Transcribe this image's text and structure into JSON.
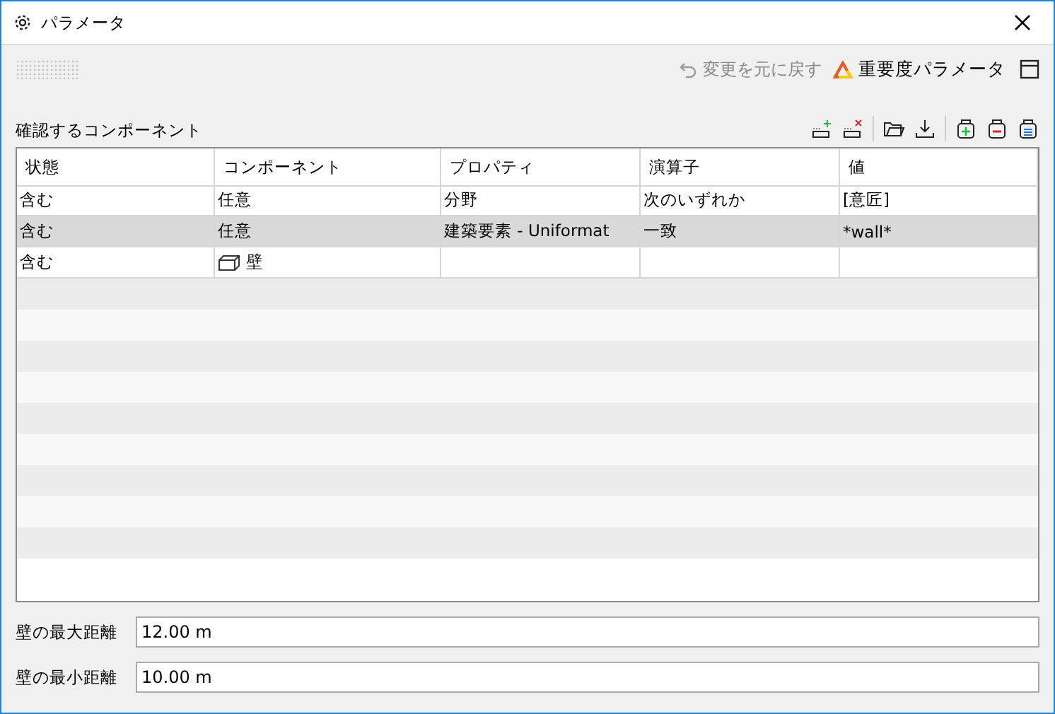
{
  "window": {
    "title": "パラメータ"
  },
  "toolbar": {
    "undo": {
      "label": "変更を元に戻す",
      "disabled": true
    },
    "severity": {
      "label": "重要度パラメータ"
    }
  },
  "section": {
    "title": "確認するコンポーネント"
  },
  "table": {
    "columns": [
      "状態",
      "コンポーネント",
      "プロパティ",
      "演算子",
      "値"
    ],
    "rows": [
      {
        "selected": false,
        "cells": [
          {
            "text": "含む"
          },
          {
            "text": "任意"
          },
          {
            "text": "分野"
          },
          {
            "text": "次のいずれか"
          },
          {
            "text": "[意匠]"
          }
        ]
      },
      {
        "selected": true,
        "cells": [
          {
            "text": "含む"
          },
          {
            "text": "任意"
          },
          {
            "text": "建築要素 - Uniformat"
          },
          {
            "text": "一致"
          },
          {
            "text": "*wall*"
          }
        ]
      },
      {
        "selected": false,
        "cells": [
          {
            "text": "含む"
          },
          {
            "text": "壁",
            "kind": "component"
          },
          {
            "text": ""
          },
          {
            "text": ""
          },
          {
            "text": ""
          }
        ]
      }
    ]
  },
  "fields": [
    {
      "label": "壁の最大距離",
      "value": "12.00 m"
    },
    {
      "label": "壁の最小距離",
      "value": "10.00 m"
    }
  ]
}
